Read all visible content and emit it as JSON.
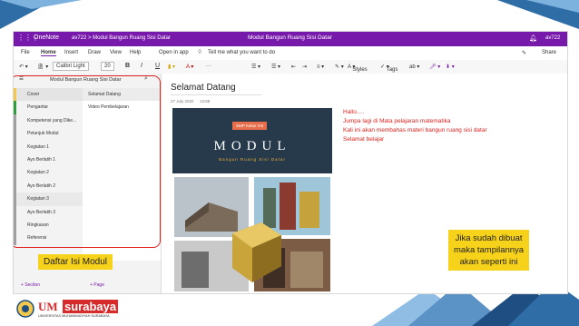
{
  "app": {
    "name": "OneNote",
    "breadcrumb": "av722 > Modul Bangun Ruang Sisi Datar",
    "window_title": "Modul Bangun Ruang Sisi Datar",
    "user": "av722"
  },
  "menu": {
    "items": [
      "File",
      "Home",
      "Insert",
      "Draw",
      "View",
      "Help",
      "Open in app"
    ],
    "tell_me": "Tell me what you want to do",
    "share": "Share"
  },
  "toolbar": {
    "font": "Calibri Light",
    "size": "20",
    "bold": "B",
    "italic": "I",
    "underline": "U",
    "styles": "Styles",
    "tags": "Tags"
  },
  "notebook": {
    "title": "Modul Bangun Ruang Sisi Datar",
    "sections": [
      {
        "label": "Cover",
        "color": "#f2c94c"
      },
      {
        "label": "Pengantar",
        "color": "#2e9e3f"
      },
      {
        "label": "Kompetensi yang Dike...",
        "color": "#a0a0a0"
      },
      {
        "label": "Petunjuk Modul",
        "color": "#a0a0a0"
      },
      {
        "label": "Kegiatan 1",
        "color": "#a0a0a0"
      },
      {
        "label": "Ayo Berlatih 1",
        "color": "#a0a0a0"
      },
      {
        "label": "Kegiatan 2",
        "color": "#a0a0a0"
      },
      {
        "label": "Ayo Berlatih 2",
        "color": "#a0a0a0"
      },
      {
        "label": "Kegiatan 3",
        "color": "#a0a0a0"
      },
      {
        "label": "Ayo Berlatih 3",
        "color": "#a0a0a0"
      },
      {
        "label": "Ringkasan",
        "color": "#a0a0a0"
      },
      {
        "label": "Referensi",
        "color": "#a0a0a0"
      }
    ],
    "pages": [
      "Selamat Datang",
      "Video Pembelajaran"
    ],
    "add_section": "+ Section",
    "add_page": "+ Page"
  },
  "page": {
    "title": "Selamat Datang",
    "date": "27 July 2020",
    "time": "13:58",
    "cover_badge": "SMP Kelas VIII",
    "cover_title": "MODUL",
    "cover_subtitle": "Bangun Ruang Sisi Datar",
    "lines": [
      "Hallo….",
      "Jumpa lagi di Mata pelajaran matematika",
      "Kali ini akan membahas materi bangun ruang sisi datar",
      "Selamat belajar"
    ]
  },
  "annotations": {
    "left": "Daftar Isi Modul",
    "right_lines": [
      "Jika sudah dibuat",
      "maka tampilannya",
      "akan seperti ini"
    ]
  },
  "footer": {
    "brand_um": "UM",
    "brand_name": "surabaya",
    "university": "UNIVERSITAS MUHAMMADIYAH SURABAYA"
  },
  "colors": {
    "onenote_purple": "#7719aa",
    "callout_red": "#e0221e",
    "highlight_yellow": "#f7d21a",
    "brand_red": "#d72b2b"
  }
}
